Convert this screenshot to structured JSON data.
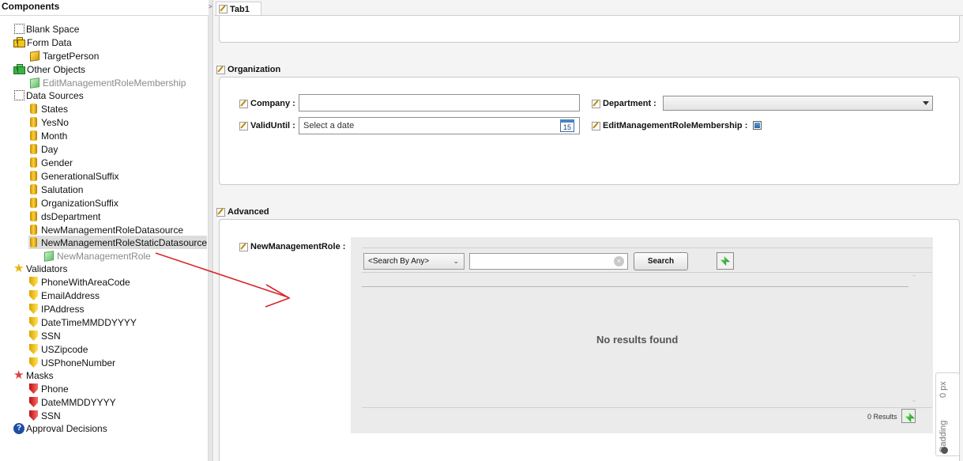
{
  "left_panel": {
    "title": "Components",
    "nodes": [
      {
        "label": "Blank Space"
      },
      {
        "label": "Form Data"
      },
      {
        "label": "TargetPerson"
      },
      {
        "label": "Other Objects"
      },
      {
        "label": "EditManagementRoleMembership"
      },
      {
        "label": "Data Sources"
      },
      {
        "label": "States"
      },
      {
        "label": "YesNo"
      },
      {
        "label": "Month"
      },
      {
        "label": "Day"
      },
      {
        "label": "Gender"
      },
      {
        "label": "GenerationalSuffix"
      },
      {
        "label": "Salutation"
      },
      {
        "label": "OrganizationSuffix"
      },
      {
        "label": "dsDepartment"
      },
      {
        "label": "NewManagementRoleDatasource"
      },
      {
        "label": "NewManagementRoleStaticDatasource"
      },
      {
        "label": "NewManagementRole"
      },
      {
        "label": "Validators"
      },
      {
        "label": "PhoneWithAreaCode"
      },
      {
        "label": "EmailAddress"
      },
      {
        "label": "IPAddress"
      },
      {
        "label": "DateTimeMMDDYYYY"
      },
      {
        "label": "SSN"
      },
      {
        "label": "USZipcode"
      },
      {
        "label": "USPhoneNumber"
      },
      {
        "label": "Masks"
      },
      {
        "label": "Phone"
      },
      {
        "label": "DateMMDDYYYY"
      },
      {
        "label": "SSN"
      },
      {
        "label": "Approval Decisions"
      }
    ]
  },
  "splitter": {
    "glyph": ">"
  },
  "tab": {
    "label": "Tab1"
  },
  "organization": {
    "title": "Organization",
    "company_label": "Company :",
    "company_value": "",
    "valid_until_label": "ValidUntil :",
    "valid_until_placeholder": "Select a date",
    "calendar_day": "15",
    "department_label": "Department :",
    "department_value": "",
    "edit_membership_label": "EditManagementRoleMembership :"
  },
  "advanced": {
    "title": "Advanced",
    "new_role_label": "NewManagementRole :",
    "search_by": "<Search By Any>",
    "search_value": "",
    "search_button": "Search",
    "empty_message": "No results found",
    "results_count": "0 Results"
  },
  "padding_widget": {
    "label": "Padding",
    "value": "0 px"
  },
  "colors": {
    "annotation_arrow": "#d8262b",
    "selected_row": "#dcdcdc"
  }
}
